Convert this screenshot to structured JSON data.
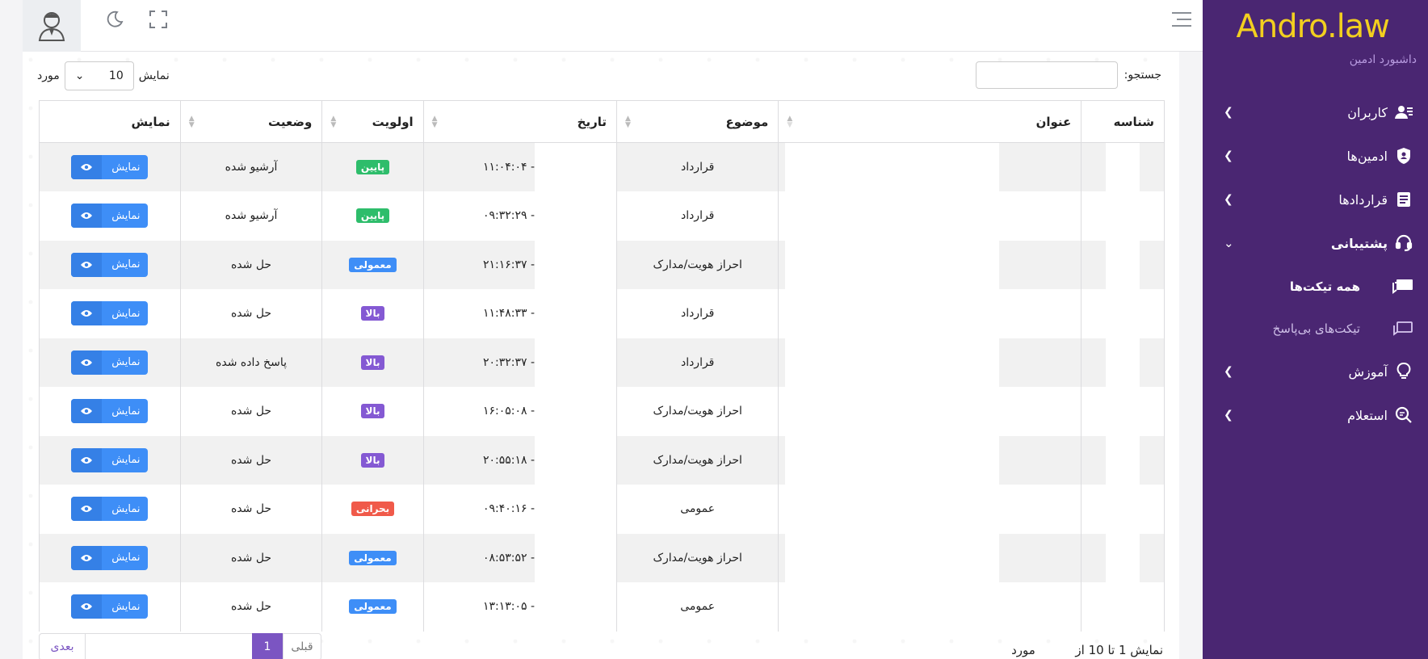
{
  "sidebar": {
    "brand": "Andro.law",
    "subtitle": "داشبورد ادمین",
    "items": [
      {
        "label": "کاربران",
        "icon": "users-icon"
      },
      {
        "label": "ادمین‌ها",
        "icon": "shield-user-icon"
      },
      {
        "label": "قراردادها",
        "icon": "document-icon"
      },
      {
        "label": "پشتیبانی",
        "icon": "headset-icon"
      },
      {
        "label": "آموزش",
        "icon": "lightbulb-icon"
      },
      {
        "label": "استعلام",
        "icon": "search-doc-icon"
      }
    ],
    "support_sub": [
      {
        "label": "همه تیکت‌ها",
        "icon": "chat-icon"
      },
      {
        "label": "تیکت‌های بی‌پاسخ",
        "icon": "chat-outline-icon"
      }
    ]
  },
  "controls": {
    "show_label": "نمایش",
    "page_length": "10",
    "items_label": "مورد",
    "search_label": "جستجو:"
  },
  "table": {
    "headers": [
      "شناسه",
      "عنوان",
      "موضوع",
      "تاریخ",
      "اولویت",
      "وضعیت",
      "نمایش"
    ],
    "view_label": "نمایش",
    "rows": [
      {
        "subject": "قرارداد",
        "date": "۱۱:۰۴:۰۴ -",
        "priority": "پایین",
        "status": "آرشیو شده"
      },
      {
        "subject": "قرارداد",
        "date": "۰۹:۳۲:۲۹ -",
        "priority": "پایین",
        "status": "آرشیو شده"
      },
      {
        "subject": "احراز هویت/مدارک",
        "date": "۲۱:۱۶:۳۷ -",
        "priority": "معمولی",
        "status": "حل شده"
      },
      {
        "subject": "قرارداد",
        "date": "۱۱:۴۸:۳۳ -",
        "priority": "بالا",
        "status": "حل شده"
      },
      {
        "subject": "قرارداد",
        "date": "۲۰:۳۲:۳۷ -",
        "priority": "بالا",
        "status": "پاسخ داده شده"
      },
      {
        "subject": "احراز هویت/مدارک",
        "date": "۱۶:۰۵:۰۸ -",
        "priority": "بالا",
        "status": "حل شده"
      },
      {
        "subject": "احراز هویت/مدارک",
        "date": "۲۰:۵۵:۱۸ -",
        "priority": "بالا",
        "status": "حل شده"
      },
      {
        "subject": "عمومی",
        "date": "۰۹:۴۰:۱۶ -",
        "priority": "بحرانی",
        "status": "حل شده"
      },
      {
        "subject": "احراز هویت/مدارک",
        "date": "۰۸:۵۳:۵۲ -",
        "priority": "معمولی",
        "status": "حل شده"
      },
      {
        "subject": "عمومی",
        "date": "۱۳:۱۳:۰۵ -",
        "priority": "معمولی",
        "status": "حل شده"
      }
    ]
  },
  "priority_colors": {
    "پایین": "#2ebd6b",
    "معمولی": "#3e8ef7",
    "بالا": "#8459d3",
    "بحرانی": "#f05a4a"
  },
  "footer": {
    "info_text": "نمایش 1 تا 10 از",
    "info_suffix": "مورد",
    "prev": "قبلی",
    "page": "1",
    "next": "بعدی"
  }
}
